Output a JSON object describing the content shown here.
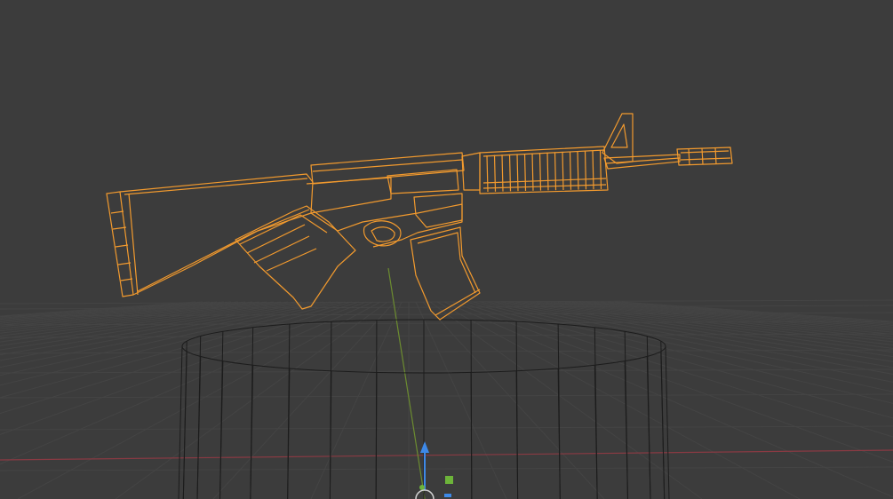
{
  "viewport": {
    "mode": "wireframe",
    "colors": {
      "background": "#3c3c3c",
      "grid_line": "#444444",
      "x_axis": "#8a3a43",
      "y_axis": "#6c8c30",
      "z_axis": "#4a7fd4",
      "selected_wire": "#f29a2e",
      "object_wire": "#1c1c1c",
      "gizmo_move": "#3d89e8",
      "gizmo_handle": "#6db43a"
    },
    "objects": [
      {
        "name": "rifle",
        "selected": true
      },
      {
        "name": "cylinder",
        "selected": false
      }
    ]
  }
}
